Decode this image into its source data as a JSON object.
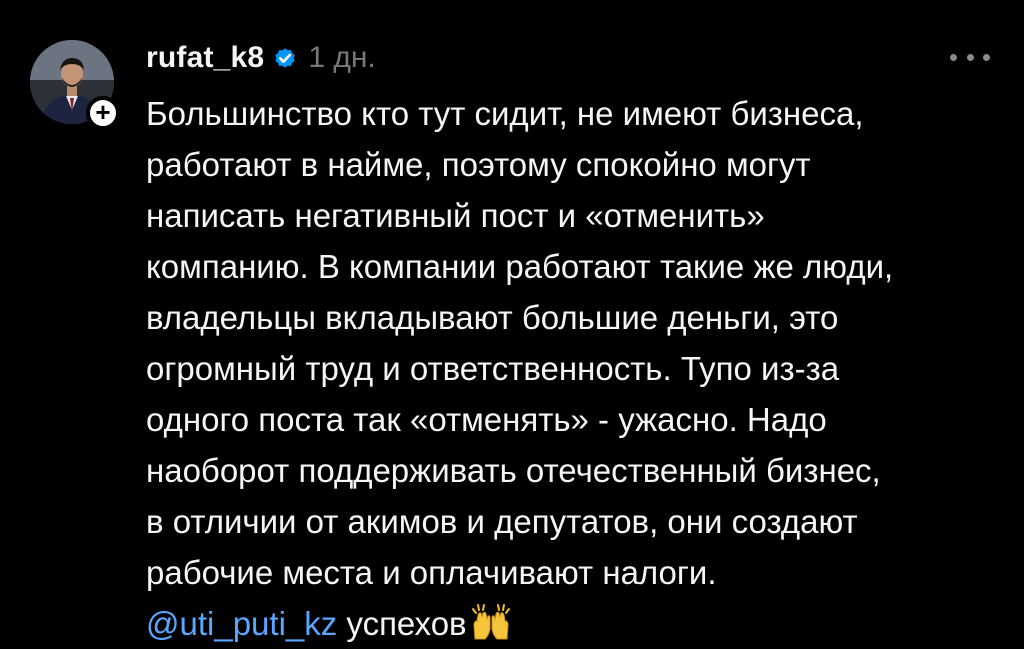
{
  "post": {
    "username": "rufat_k8",
    "verified": true,
    "time": "1 дн.",
    "lines": [
      "Большинство кто тут сидит, не имеют бизнеса,",
      "работают в найме, поэтому спокойно могут",
      "написать негативный пост и «отменить»",
      "компанию. В компании работают такие же люди,",
      "владельцы вкладывают большие деньги, это",
      "огромный труд и ответственность. Тупо из-за",
      "одного поста так «отменять» - ужасно. Надо",
      "наоборот поддерживать отечественный бизнес,",
      "в отличии от акимов и депутатов, они создают",
      "рабочие места и оплачивают налоги."
    ],
    "last_line": {
      "mention": "@uti_puti_kz",
      "text": " успехов",
      "emoji": "raising-hands-emoji"
    }
  },
  "icons": {
    "more": "more-options-icon",
    "follow": "plus-icon",
    "verified": "verified-badge-icon"
  },
  "colors": {
    "background": "#000000",
    "text": "#f3f5f7",
    "muted": "#777777",
    "mention": "#5aa6ff",
    "verified": "#0095f6"
  }
}
